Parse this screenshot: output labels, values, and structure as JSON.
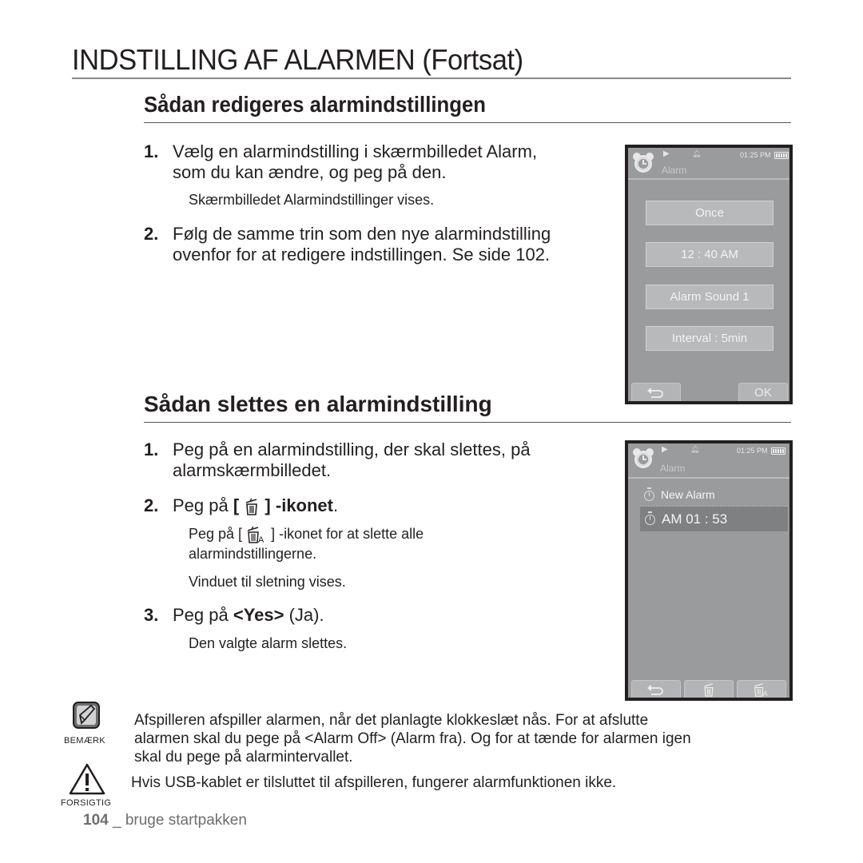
{
  "page": {
    "title": "INDSTILLING AF ALARMEN (Fortsat)",
    "footer": {
      "page_number": "104",
      "separator": "_",
      "text": "bruge startpakken"
    }
  },
  "section_edit": {
    "title": "Sådan redigeres alarmindstillingen",
    "steps": [
      {
        "num": "1.",
        "line1": "Vælg en alarmindstilling i skærmbilledet Alarm,",
        "line2": "som du kan ændre, og peg på den.",
        "sub": "Skærmbilledet Alarmindstillinger vises."
      },
      {
        "num": "2.",
        "line1": "Følg de samme trin som den nye alarmindstilling",
        "line2": "ovenfor for at redigere indstillingen. Se side 102."
      }
    ]
  },
  "section_delete": {
    "title": "Sådan slettes en alarmindstilling",
    "steps": [
      {
        "num": "1.",
        "line1": "Peg på en alarmindstilling, der skal slettes, på",
        "line2": "alarmskærmbilledet."
      },
      {
        "num": "2.",
        "prefix": "Peg på ",
        "bracket_open": "[",
        "bracket_close": "]",
        "bold": "-ikonet",
        "suffix": ".",
        "sub_prefix": "Peg på [",
        "sub_suffix": "] -ikonet for at slette alle",
        "sub_line2": "alarmindstillingerne.",
        "sub2": "Vinduet til sletning vises.",
        "icon": "trash-icon",
        "sub_icon": "trash-all-icon"
      },
      {
        "num": "3.",
        "prefix": "Peg på ",
        "bold": "<Yes>",
        "suffix": " (Ja).",
        "sub": "Den valgte alarm slettes."
      }
    ]
  },
  "device_settings": {
    "status_time": "01:25 PM",
    "screen_label": "Alarm",
    "options": [
      "Once",
      "12 : 40 AM",
      "Alarm Sound 1",
      "Interval : 5min"
    ],
    "bottom_buttons": [
      {
        "icon": "back-arrow-icon",
        "label": "⮌"
      },
      {
        "label": "OK"
      }
    ]
  },
  "device_list": {
    "status_time": "01:25 PM",
    "screen_label": "Alarm",
    "items": [
      {
        "label": "New Alarm",
        "selected": false
      },
      {
        "label": "AM 01 : 53",
        "selected": true
      }
    ],
    "bottom_buttons": [
      {
        "icon": "back-arrow-icon"
      },
      {
        "icon": "trash-icon"
      },
      {
        "icon": "trash-all-icon"
      }
    ]
  },
  "notes": {
    "note_label": "BEMÆRK",
    "note_lines": [
      "Afspilleren afspiller alarmen, når det planlagte klokkeslæt nås. For at afslutte",
      "alarmen skal du pege på <Alarm Off> (Alarm fra). Og for at tænde for alarmen igen",
      "skal du pege på alarmintervallet."
    ],
    "caution_label": "FORSIGTIG",
    "caution_text": "Hvis USB-kablet er tilsluttet til afspilleren, fungerer alarmfunktionen ikke."
  }
}
